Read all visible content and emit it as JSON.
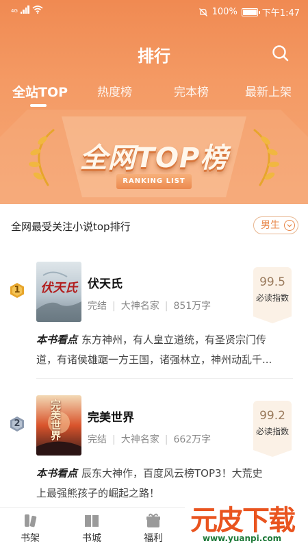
{
  "status_bar": {
    "network": "4G",
    "battery": "100%",
    "time": "下午1:47"
  },
  "header": {
    "title": "排行",
    "search_icon": "search-icon"
  },
  "tabs": [
    {
      "label": "全站TOP",
      "active": true
    },
    {
      "label": "热度榜",
      "active": false
    },
    {
      "label": "完本榜",
      "active": false
    },
    {
      "label": "最新上架",
      "active": false
    }
  ],
  "banner": {
    "title": "全网TOP榜",
    "ribbon": "RANKING LIST"
  },
  "list_header": {
    "title": "全网最受关注小说top排行",
    "gender": "男生"
  },
  "books": [
    {
      "rank": "1",
      "title": "伏天氏",
      "cover_text": "伏天氏",
      "status": "完结",
      "author": "大神名家",
      "words": "851万字",
      "score": "99.5",
      "score_label": "必读指数",
      "highlight_label": "本书看点",
      "blurb_line1": "东方神州，有人皇立道统，有圣贤宗门传",
      "blurb_line2": "道，有诸侯雄踞一方王国，诸强林立，神州动乱千..."
    },
    {
      "rank": "2",
      "title": "完美世界",
      "cover_text": "完美世界",
      "status": "完结",
      "author": "大神名家",
      "words": "662万字",
      "score": "99.2",
      "score_label": "必读指数",
      "highlight_label": "本书看点",
      "blurb_line1": "辰东大神作，百度风云榜TOP3！大荒史",
      "blurb_line2": "上最强熊孩子的崛起之路！"
    }
  ],
  "bottom_nav": [
    {
      "label": "书架",
      "icon": "bookshelf-icon"
    },
    {
      "label": "书城",
      "icon": "book-icon"
    },
    {
      "label": "福利",
      "icon": "gift-icon"
    }
  ],
  "watermark": {
    "title": "元皮下载",
    "url": "www.yuanpi.com"
  },
  "colors": {
    "accent": "#f08a52",
    "score_bg": "#fbf1e6",
    "gold": "#e7a52b",
    "silver": "#8d9bb0"
  }
}
